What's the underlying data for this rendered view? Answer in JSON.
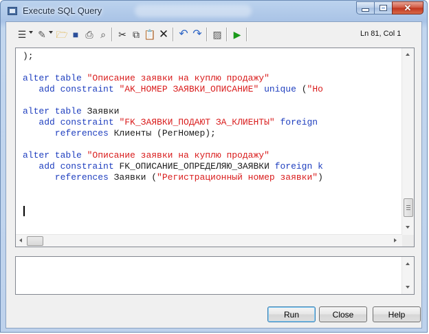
{
  "window": {
    "title": "Execute SQL Query"
  },
  "toolbar": {
    "icons": [
      "list-icon",
      "edit-icon",
      "open-folder-icon",
      "save-icon",
      "print-icon",
      "find-icon",
      "cut-icon",
      "copy-icon",
      "paste-icon",
      "delete-icon",
      "undo-icon",
      "redo-icon",
      "clear-icon",
      "run-icon"
    ],
    "cursor_position": "Ln 81, Col 1"
  },
  "editor": {
    "lines": [
      [
        {
          "t": ");",
          "c": "p"
        }
      ],
      [],
      [
        {
          "t": "alter table ",
          "c": "kw"
        },
        {
          "t": "\"Описание заявки на куплю продажу\"",
          "c": "str"
        }
      ],
      [
        {
          "t": "   add constraint ",
          "c": "kw"
        },
        {
          "t": "\"AK_НОМЕР ЗАЯВКИ_ОПИСАНИЕ\"",
          "c": "str"
        },
        {
          "t": " unique ",
          "c": "kw"
        },
        {
          "t": "(",
          "c": "p"
        },
        {
          "t": "\"Но",
          "c": "str"
        }
      ],
      [],
      [
        {
          "t": "alter table ",
          "c": "kw"
        },
        {
          "t": "Заявки",
          "c": "p"
        }
      ],
      [
        {
          "t": "   add constraint ",
          "c": "kw"
        },
        {
          "t": "\"FK_ЗАЯВКИ_ПОДАЮТ ЗА_КЛИЕНТЫ\"",
          "c": "str"
        },
        {
          "t": " foreign",
          "c": "kw"
        }
      ],
      [
        {
          "t": "      references ",
          "c": "kw"
        },
        {
          "t": "Клиенты (РегНомер);",
          "c": "p"
        }
      ],
      [],
      [
        {
          "t": "alter table ",
          "c": "kw"
        },
        {
          "t": "\"Описание заявки на куплю продажу\"",
          "c": "str"
        }
      ],
      [
        {
          "t": "   add constraint ",
          "c": "kw"
        },
        {
          "t": "FK_ОПИСАНИЕ_ОПРЕДЕЛЯЮ_ЗАЯВКИ",
          "c": "p"
        },
        {
          "t": " foreign k",
          "c": "kw"
        }
      ],
      [
        {
          "t": "      references ",
          "c": "kw"
        },
        {
          "t": "Заявки (",
          "c": "p"
        },
        {
          "t": "\"Регистрационный номер заявки\"",
          "c": "str"
        },
        {
          "t": ")",
          "c": "p"
        }
      ]
    ]
  },
  "messages": {
    "text": ""
  },
  "buttons": {
    "run": "Run",
    "close": "Close",
    "help": "Help"
  }
}
